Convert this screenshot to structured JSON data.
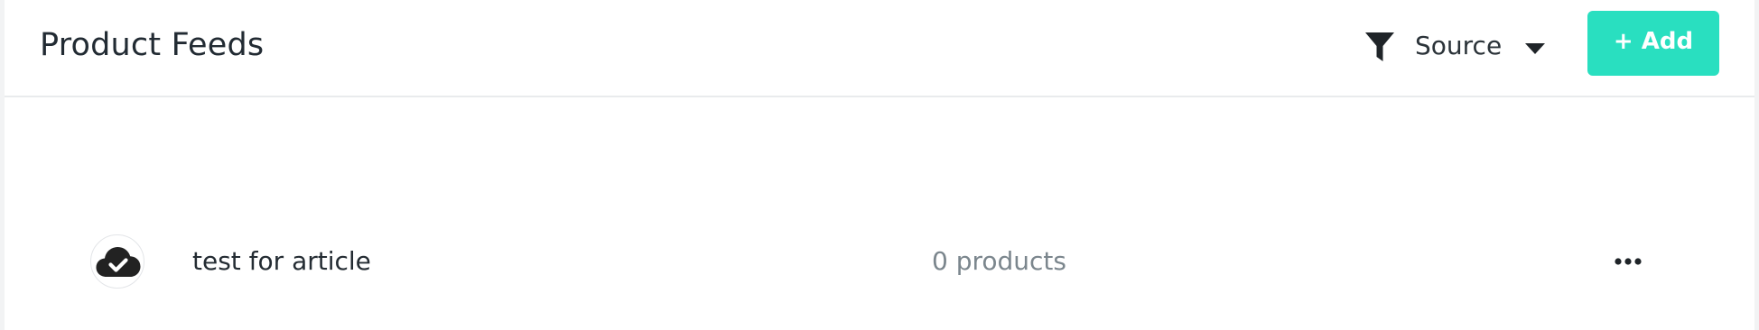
{
  "header": {
    "title": "Product Feeds",
    "filter_icon": "filter-funnel-icon",
    "source_label": "Source",
    "caret_icon": "caret-down-icon",
    "add_label": "+ Add"
  },
  "feeds": [
    {
      "icon": "cloud-check-icon",
      "name": "test for article",
      "count": "0 products",
      "more_icon": "more-horizontal-icon"
    }
  ],
  "colors": {
    "accent": "#29dfc0",
    "title_text": "#222b33",
    "muted_text": "#7b868d",
    "icon_dark": "#222222",
    "divider": "#e9ebed"
  }
}
